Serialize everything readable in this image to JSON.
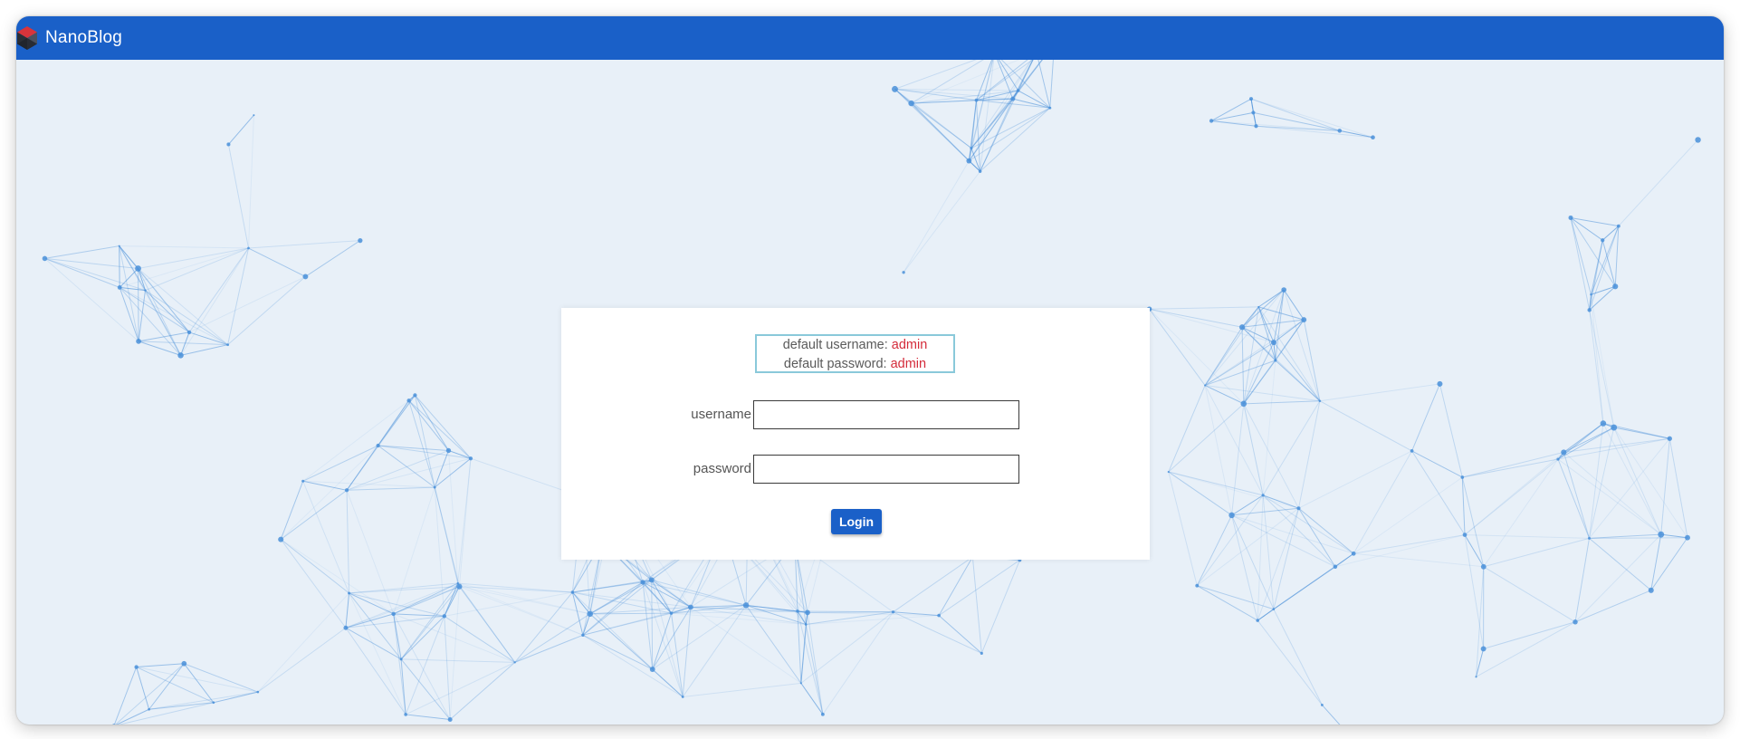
{
  "app": {
    "brand_name": "NanoBlog",
    "logo_icon": "hexagon-cube-logo-icon"
  },
  "login": {
    "defaults": {
      "username_label": "default username: ",
      "username_value": "admin",
      "password_label": "default password: ",
      "password_value": "admin"
    },
    "username_label": "username",
    "username_value": "",
    "password_label": "password",
    "password_value": "",
    "submit_label": "Login"
  },
  "colors": {
    "navbar": "#1a60c8",
    "page_background": "#e8f0f8",
    "network_lines": "#4a90d9",
    "defaults_border": "#8ac9da",
    "defaults_value": "#d42b3a",
    "button": "#1a60c8"
  }
}
